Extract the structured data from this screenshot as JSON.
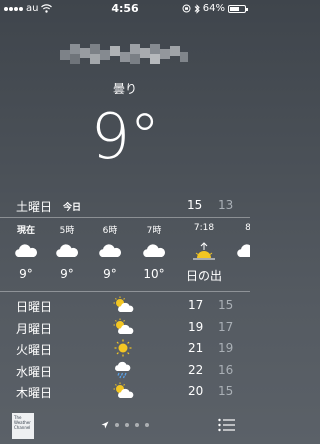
{
  "status_bar": {
    "carrier": "au",
    "time": "4:56",
    "battery": "64%",
    "battery_level": 0.64
  },
  "current": {
    "location": "",
    "condition": "曇り",
    "temperature": "9°"
  },
  "today": {
    "day": "土曜日",
    "label": "今日",
    "high": "15",
    "low": "13"
  },
  "hourly": [
    {
      "time": "現在",
      "icon": "cloud-icon",
      "temp": "9°"
    },
    {
      "time": "5時",
      "icon": "cloud-icon",
      "temp": "9°"
    },
    {
      "time": "6時",
      "icon": "cloud-icon",
      "temp": "9°"
    },
    {
      "time": "7時",
      "icon": "cloud-icon",
      "temp": "10°"
    },
    {
      "time": "7:18",
      "icon": "sunrise-icon",
      "temp": "日の出"
    },
    {
      "time": "8",
      "icon": "cloud-icon",
      "temp": ""
    }
  ],
  "daily": [
    {
      "day": "日曜日",
      "icon": "partly-sunny-icon",
      "high": "17",
      "low": "15"
    },
    {
      "day": "月曜日",
      "icon": "partly-sunny-icon",
      "high": "19",
      "low": "17"
    },
    {
      "day": "火曜日",
      "icon": "sunny-icon",
      "high": "21",
      "low": "19"
    },
    {
      "day": "水曜日",
      "icon": "rain-icon",
      "high": "22",
      "low": "16"
    },
    {
      "day": "木曜日",
      "icon": "partly-sunny-icon",
      "high": "20",
      "low": "15"
    }
  ],
  "footer": {
    "provider": "The Weather Channel",
    "page_count": 5,
    "active_page": 0
  }
}
